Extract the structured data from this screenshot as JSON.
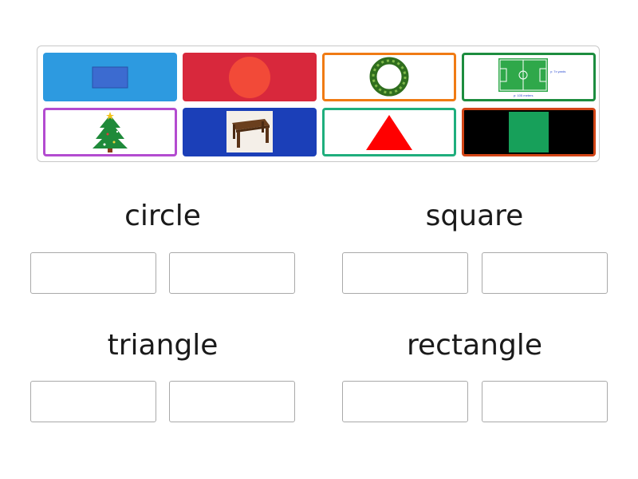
{
  "cards": [
    {
      "id": "blue-rectangle-card",
      "depicts": "blue rectangle",
      "bg": "#2d9ae0",
      "border": "#2d9ae0"
    },
    {
      "id": "red-circle-card",
      "depicts": "red circle",
      "bg": "#d8283c",
      "border": "#d8283c"
    },
    {
      "id": "wreath-card",
      "depicts": "green wreath",
      "bg": "#ffffff",
      "border": "#f07b14"
    },
    {
      "id": "football-field-card",
      "depicts": "football field",
      "bg": "#ffffff",
      "border": "#1d8d3f",
      "field_caption": "p: 105 meters",
      "field_side_caption": "y: 7x yards"
    },
    {
      "id": "christmas-tree-card",
      "depicts": "christmas tree",
      "bg": "#ffffff",
      "border": "#b34bd0"
    },
    {
      "id": "table-card",
      "depicts": "wooden table",
      "bg": "#1b3fb8",
      "border": "#1b3fb8"
    },
    {
      "id": "red-triangle-card",
      "depicts": "red triangle",
      "bg": "#ffffff",
      "border": "#1fae7d"
    },
    {
      "id": "green-square-card",
      "depicts": "green square",
      "bg": "#000000",
      "border": "#d24516"
    }
  ],
  "categories": [
    {
      "title": "circle"
    },
    {
      "title": "square"
    },
    {
      "title": "triangle"
    },
    {
      "title": "rectangle"
    }
  ],
  "colors": {
    "slot_border": "#a9a9a9",
    "tray_border": "#c8c8c8",
    "title_text": "#1a1a1a"
  }
}
